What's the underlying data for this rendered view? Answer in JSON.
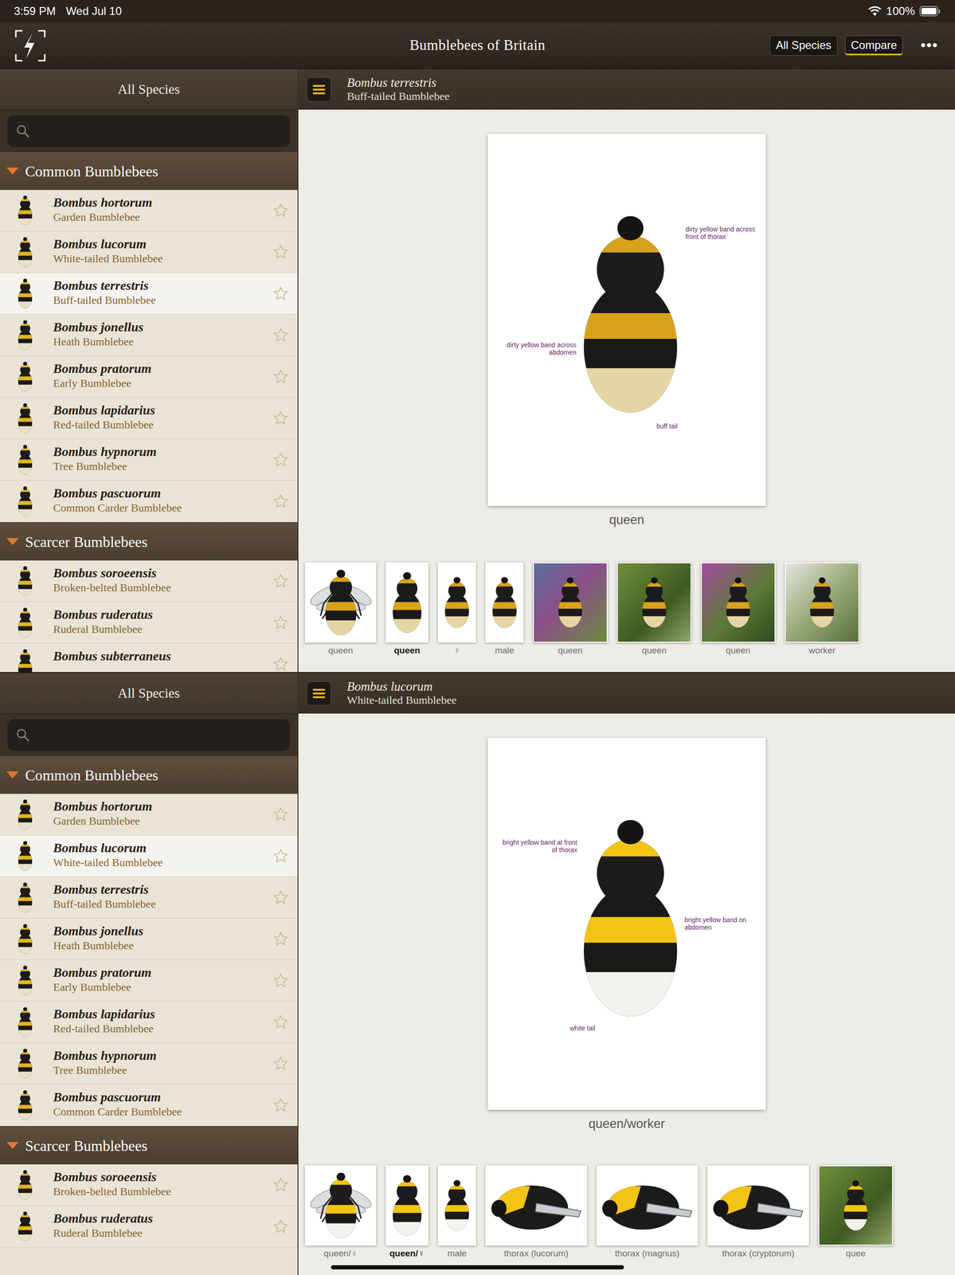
{
  "status_bar": {
    "time": "3:59 PM",
    "date": "Wed Jul 10",
    "battery": "100%",
    "battery_level": 1
  },
  "navbar": {
    "title": "Bumblebees of Britain",
    "buttons": [
      {
        "label": "All Species",
        "selected": false
      },
      {
        "label": "Compare",
        "selected": true
      }
    ],
    "more": "•••"
  },
  "panes": [
    {
      "sidebar": {
        "title": "All Species",
        "sections": [
          {
            "title": "Common Bumblebees",
            "expanded": true,
            "items": [
              {
                "latin": "Bombus hortorum",
                "common": "Garden Bumblebee",
                "favorite": false,
                "selected": false
              },
              {
                "latin": "Bombus lucorum",
                "common": "White-tailed Bumblebee",
                "favorite": false,
                "selected": false
              },
              {
                "latin": "Bombus terrestris",
                "common": "Buff-tailed Bumblebee",
                "favorite": false,
                "selected": true
              },
              {
                "latin": "Bombus jonellus",
                "common": "Heath Bumblebee",
                "favorite": false,
                "selected": false
              },
              {
                "latin": "Bombus pratorum",
                "common": "Early Bumblebee",
                "favorite": false,
                "selected": false
              },
              {
                "latin": "Bombus lapidarius",
                "common": "Red-tailed Bumblebee",
                "favorite": false,
                "selected": false
              },
              {
                "latin": "Bombus hypnorum",
                "common": "Tree Bumblebee",
                "favorite": false,
                "selected": false
              },
              {
                "latin": "Bombus pascuorum",
                "common": "Common Carder Bumblebee",
                "favorite": false,
                "selected": false
              }
            ]
          },
          {
            "title": "Scarcer Bumblebees",
            "expanded": true,
            "items": [
              {
                "latin": "Bombus soroeensis",
                "common": "Broken-belted Bumblebee",
                "favorite": false,
                "selected": false
              },
              {
                "latin": "Bombus ruderatus",
                "common": "Ruderal Bumblebee",
                "favorite": false,
                "selected": false
              },
              {
                "latin": "Bombus subterraneus",
                "favorite": false,
                "selected": false
              }
            ]
          }
        ]
      },
      "detail": {
        "latin": "Bombus terrestris",
        "common": "Buff-tailed Bumblebee",
        "plate": {
          "caption": "queen",
          "band_color": "#d9a21c",
          "tail_color": "#e6d5a4",
          "annotations": [
            "dirty yellow band across front of thorax",
            "dirty yellow band across abdomen",
            "buff tail"
          ]
        },
        "thumbnails": [
          {
            "label": "queen",
            "kind": "spread",
            "selected": false
          },
          {
            "label": "queen",
            "kind": "dorsal",
            "selected": true
          },
          {
            "label": "♀",
            "kind": "small",
            "selected": false
          },
          {
            "label": "male",
            "kind": "small",
            "selected": false
          },
          {
            "label": "queen",
            "kind": "photo",
            "selected": false
          },
          {
            "label": "queen",
            "kind": "photo",
            "selected": false
          },
          {
            "label": "queen",
            "kind": "photo",
            "selected": false
          },
          {
            "label": "worker",
            "kind": "photo",
            "selected": false
          }
        ]
      }
    },
    {
      "sidebar": {
        "title": "All Species",
        "sections": [
          {
            "title": "Common Bumblebees",
            "expanded": true,
            "items": [
              {
                "latin": "Bombus hortorum",
                "common": "Garden Bumblebee",
                "favorite": false,
                "selected": false
              },
              {
                "latin": "Bombus lucorum",
                "common": "White-tailed Bumblebee",
                "favorite": false,
                "selected": true
              },
              {
                "latin": "Bombus terrestris",
                "common": "Buff-tailed Bumblebee",
                "favorite": false,
                "selected": false
              },
              {
                "latin": "Bombus jonellus",
                "common": "Heath Bumblebee",
                "favorite": false,
                "selected": false
              },
              {
                "latin": "Bombus pratorum",
                "common": "Early Bumblebee",
                "favorite": false,
                "selected": false
              },
              {
                "latin": "Bombus lapidarius",
                "common": "Red-tailed Bumblebee",
                "favorite": false,
                "selected": false
              },
              {
                "latin": "Bombus hypnorum",
                "common": "Tree Bumblebee",
                "favorite": false,
                "selected": false
              },
              {
                "latin": "Bombus pascuorum",
                "common": "Common Carder Bumblebee",
                "favorite": false,
                "selected": false
              }
            ]
          },
          {
            "title": "Scarcer Bumblebees",
            "expanded": true,
            "items": [
              {
                "latin": "Bombus soroeensis",
                "common": "Broken-belted Bumblebee",
                "favorite": false,
                "selected": false
              },
              {
                "latin": "Bombus ruderatus",
                "common": "Ruderal Bumblebee",
                "favorite": false,
                "selected": false
              }
            ]
          }
        ]
      },
      "detail": {
        "latin": "Bombus lucorum",
        "common": "White-tailed Bumblebee",
        "plate": {
          "caption": "queen/worker",
          "band_color": "#f2c416",
          "tail_color": "#f3f2ee",
          "annotations": [
            "bright yellow band at front of thorax",
            "bright yellow band on abdomen",
            "white tail"
          ]
        },
        "thumbnails": [
          {
            "label": "queen/♀",
            "kind": "spread",
            "selected": false
          },
          {
            "label": "queen/♀",
            "kind": "dorsal",
            "selected": true
          },
          {
            "label": "male",
            "kind": "small",
            "selected": false
          },
          {
            "label": "thorax (lucorum)",
            "kind": "thorax",
            "selected": false
          },
          {
            "label": "thorax (magnus)",
            "kind": "thorax",
            "selected": false
          },
          {
            "label": "thorax (cryptorum)",
            "kind": "thorax",
            "selected": false
          },
          {
            "label": "quee",
            "kind": "photo",
            "selected": false
          }
        ]
      }
    }
  ]
}
